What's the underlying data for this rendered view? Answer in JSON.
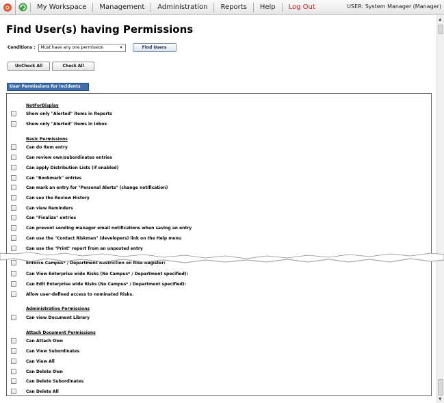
{
  "topbar": {
    "nav": [
      "My Workspace",
      "Management",
      "Administration",
      "Reports",
      "Help",
      "Log Out"
    ],
    "user": "USER: System Manager (Manager)"
  },
  "page": {
    "title": "Find User(s) having Permissions",
    "conditions_label": "Conditions :",
    "condition_value": "Must have any one permission",
    "find_button": "Find Users",
    "uncheck_all": "UnCheck All",
    "check_all": "Check All",
    "section_tab": "User Permissions for Incidents"
  },
  "permissions": {
    "groups": [
      {
        "heading": "NotForDisplay",
        "items": [
          "Show only \"Alerted\" items in Reports",
          "Show only \"Alerted\" items in Inbox"
        ]
      },
      {
        "heading": "Basic Permissions",
        "items": [
          "Can do Item entry",
          "Can review own/subordinates entries",
          "Can apply Distribution Lists (if enabled)",
          "Can \"Bookmark\" entries",
          "Can mark an entry for \"Personal Alerts\" (change notification)",
          "Can see the Review History",
          "Can view Reminders",
          "Can \"Finalize\" entries",
          "Can prevent sending manager email notifications when saving an entry",
          "Can use the \"Contact Riskman\" (developers) link on the Help menu",
          "Can use the \"Print\" report from an unposted entry"
        ]
      },
      {
        "heading": "",
        "items": [
          "Enforce Campus* / Department Restriction on Risk Register:",
          "Can View Enterprise wide Risks (No Campus* / Department specified):",
          "Can Edit Enterprise wide Risks (No Campus* / Department specified):",
          "Allow user-defined access to nominated Risks."
        ]
      },
      {
        "heading": "Administrative Permissions",
        "items": [
          "Can view Document Library"
        ]
      },
      {
        "heading": "Attach Document Permissions",
        "items": [
          "Can Attach Own",
          "Can View Subordinates",
          "Can View All",
          "Can Delete Own",
          "Can Delete Subordinates",
          "Can Delete All"
        ]
      }
    ]
  },
  "colors": {
    "accent": "#3f6ea8",
    "logout": "#d01818"
  }
}
